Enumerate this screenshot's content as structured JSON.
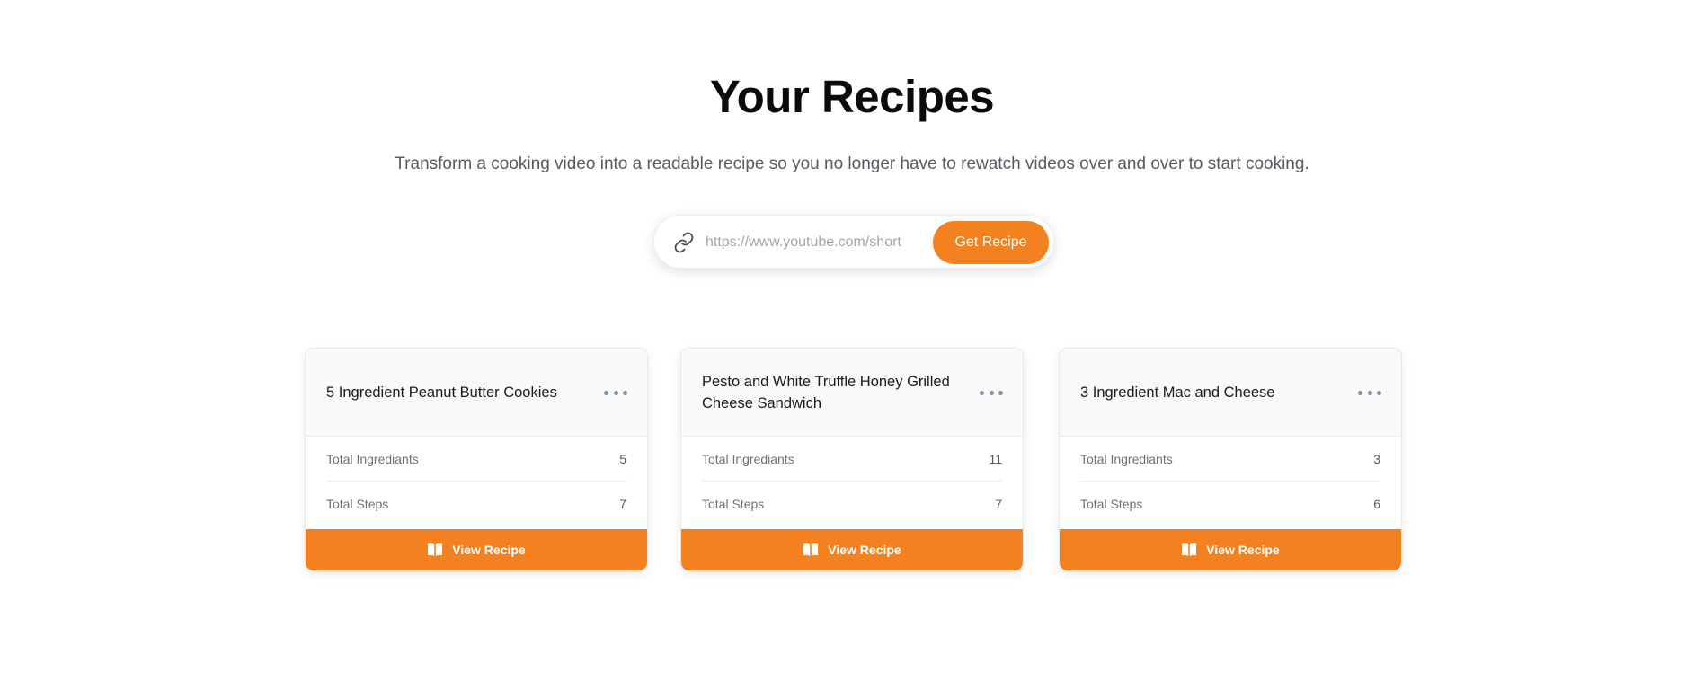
{
  "header": {
    "title": "Your Recipes",
    "subtitle": "Transform a cooking video into a readable recipe so you no longer have to rewatch videos over and over to start cooking."
  },
  "search": {
    "icon": "link-icon",
    "placeholder": "https://www.youtube.com/short",
    "value": "",
    "button_label": "Get Recipe"
  },
  "colors": {
    "accent": "#f4811f",
    "card_header_bg": "#f8f9fa"
  },
  "recipes": [
    {
      "title": "5 Ingredient Peanut Butter Cookies",
      "ingredients_label": "Total Ingrediants",
      "ingredients_value": "5",
      "steps_label": "Total Steps",
      "steps_value": "7",
      "menu_icon": "more-horizontal-icon",
      "button_icon": "book-open-icon",
      "button_label": "View Recipe"
    },
    {
      "title": "Pesto and White Truffle Honey Grilled Cheese Sandwich",
      "ingredients_label": "Total Ingrediants",
      "ingredients_value": "11",
      "steps_label": "Total Steps",
      "steps_value": "7",
      "menu_icon": "more-horizontal-icon",
      "button_icon": "book-open-icon",
      "button_label": "View Recipe"
    },
    {
      "title": "3 Ingredient Mac and Cheese",
      "ingredients_label": "Total Ingrediants",
      "ingredients_value": "3",
      "steps_label": "Total Steps",
      "steps_value": "6",
      "menu_icon": "more-horizontal-icon",
      "button_icon": "book-open-icon",
      "button_label": "View Recipe"
    }
  ]
}
